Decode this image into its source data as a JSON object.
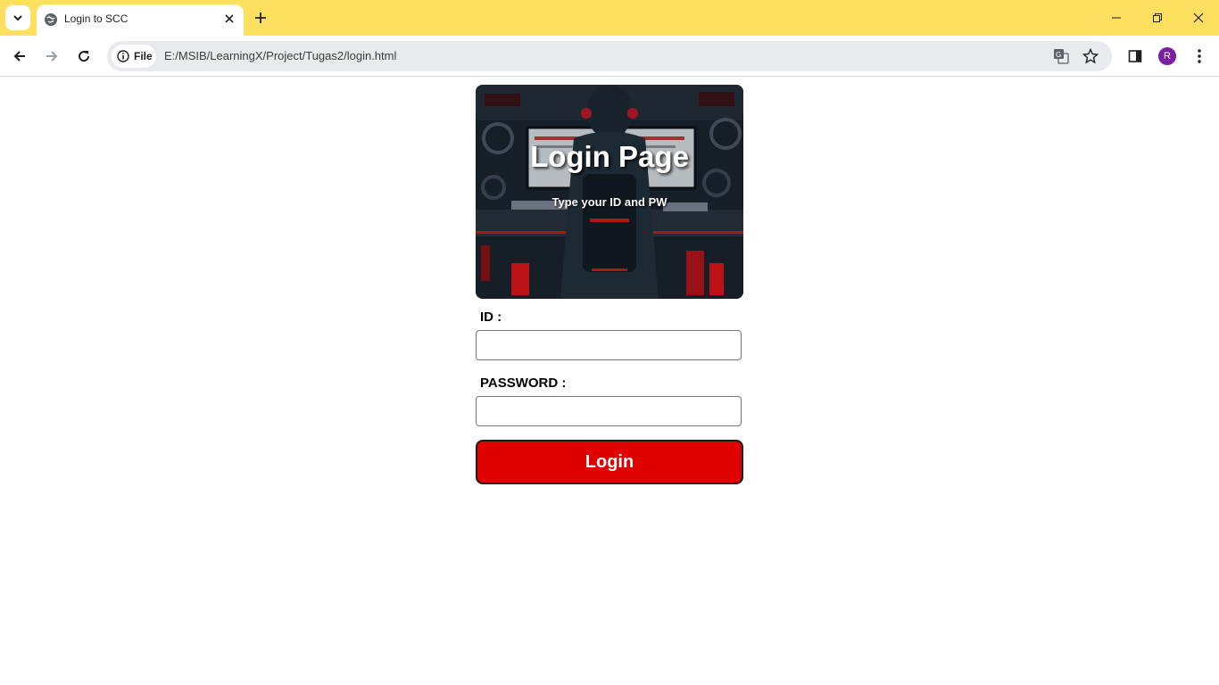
{
  "browser": {
    "tab": {
      "title": "Login to SCC"
    },
    "omnibox": {
      "chip_label": "File",
      "url": "E:/MSIB/LearningX/Project/Tugas2/login.html"
    },
    "profile_initial": "R",
    "colors": {
      "tabstrip": "#fde05f",
      "avatar": "#7b1fa2"
    }
  },
  "page": {
    "hero": {
      "title": "Login Page",
      "subtitle": "Type your ID and PW"
    },
    "form": {
      "id_label": "ID :",
      "id_value": "",
      "password_label": "PASSWORD :",
      "password_value": "",
      "submit_label": "Login"
    },
    "colors": {
      "button": "#e00000"
    }
  }
}
